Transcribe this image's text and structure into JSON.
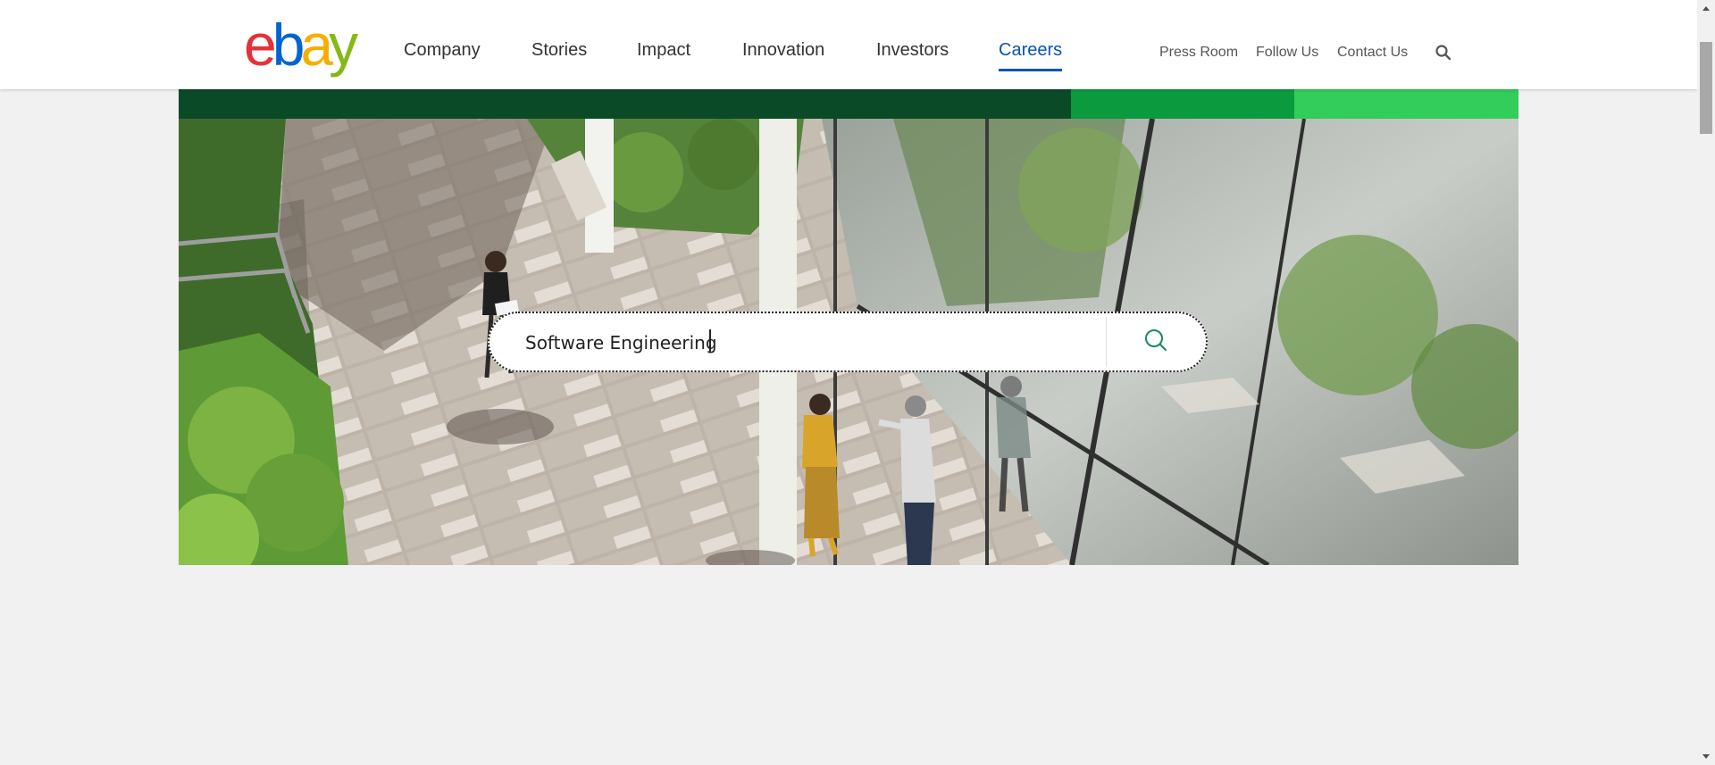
{
  "header": {
    "logo": {
      "letters": [
        "e",
        "b",
        "a",
        "y"
      ],
      "colors": [
        "#e53238",
        "#0064d2",
        "#f5af02",
        "#86b817"
      ]
    },
    "nav": [
      {
        "label": "Company",
        "active": false
      },
      {
        "label": "Stories",
        "active": false
      },
      {
        "label": "Impact",
        "active": false
      },
      {
        "label": "Innovation",
        "active": false
      },
      {
        "label": "Investors",
        "active": false
      },
      {
        "label": "Careers",
        "active": true
      }
    ],
    "utility_links": [
      "Press Room",
      "Follow Us",
      "Contact Us"
    ],
    "search_icon": "search-icon"
  },
  "color_bars": [
    "#0a4a27",
    "#0b9a3e",
    "#32cd5a"
  ],
  "hero": {
    "search": {
      "value": "Software Engineering",
      "placeholder": "",
      "button_icon": "search-icon"
    }
  },
  "colors": {
    "accent": "#0654ba",
    "search_icon": "#1a8a5a"
  }
}
